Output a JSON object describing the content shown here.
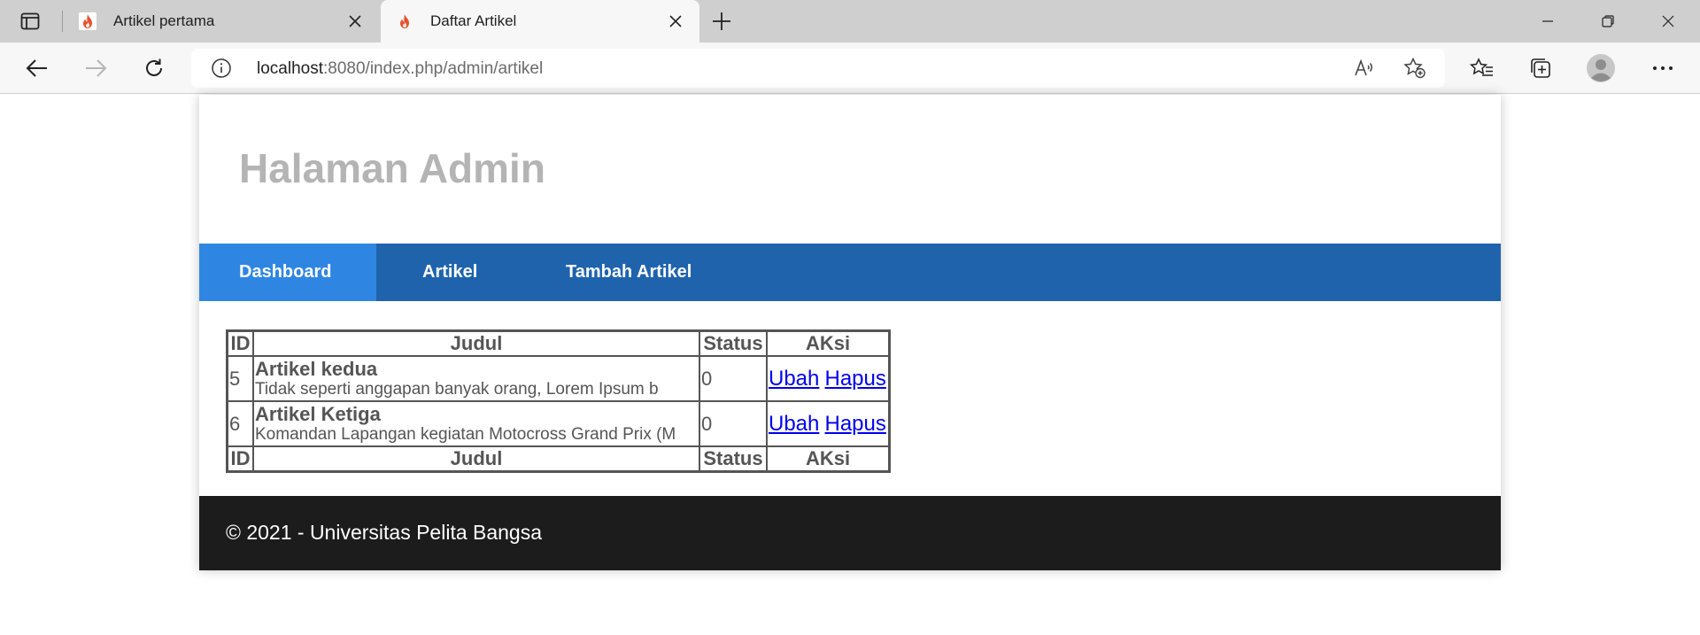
{
  "browser": {
    "tabs": [
      {
        "title": "Artikel pertama"
      },
      {
        "title": "Daftar Artikel"
      }
    ],
    "url": {
      "host": "localhost",
      "path": ":8080/index.php/admin/artikel"
    }
  },
  "page": {
    "header": {
      "title": "Halaman Admin"
    },
    "nav": {
      "items": [
        {
          "label": "Dashboard"
        },
        {
          "label": "Artikel"
        },
        {
          "label": "Tambah Artikel"
        }
      ]
    },
    "table": {
      "headers": {
        "id": "ID",
        "judul": "Judul",
        "status": "Status",
        "aksi": "AKsi"
      },
      "rows": [
        {
          "id": "5",
          "title": "Artikel kedua",
          "excerpt": "Tidak seperti anggapan banyak orang, Lorem Ipsum b",
          "status": "0",
          "edit_label": "Ubah",
          "delete_label": "Hapus"
        },
        {
          "id": "6",
          "title": "Artikel Ketiga",
          "excerpt": "Komandan Lapangan kegiatan Motocross Grand Prix (M",
          "status": "0",
          "edit_label": "Ubah",
          "delete_label": "Hapus"
        }
      ]
    },
    "footer": {
      "text": "© 2021 - Universitas Pelita Bangsa"
    }
  },
  "colors": {
    "nav_bg": "#1f63ad",
    "nav_active_bg": "#2f86e2",
    "header_title": "#b4b4b4",
    "footer_bg": "#1c1c1c",
    "link": "#0000ee",
    "favicon": "#e8522b"
  },
  "icons": {
    "tab_actions": "tab-actions-icon",
    "favicon": "flame-icon",
    "tab_close": "close-icon",
    "new_tab": "plus-icon",
    "minimize": "minimize-icon",
    "maximize": "restore-icon",
    "window_close": "close-icon",
    "back": "arrow-left-icon",
    "forward": "arrow-right-icon",
    "reload": "reload-icon",
    "site_info": "info-icon",
    "read_aloud": "read-aloud-icon",
    "add_favorite": "star-add-icon",
    "favorites": "favorites-icon",
    "collections": "collections-icon",
    "profile": "profile-icon",
    "more": "more-icon"
  }
}
